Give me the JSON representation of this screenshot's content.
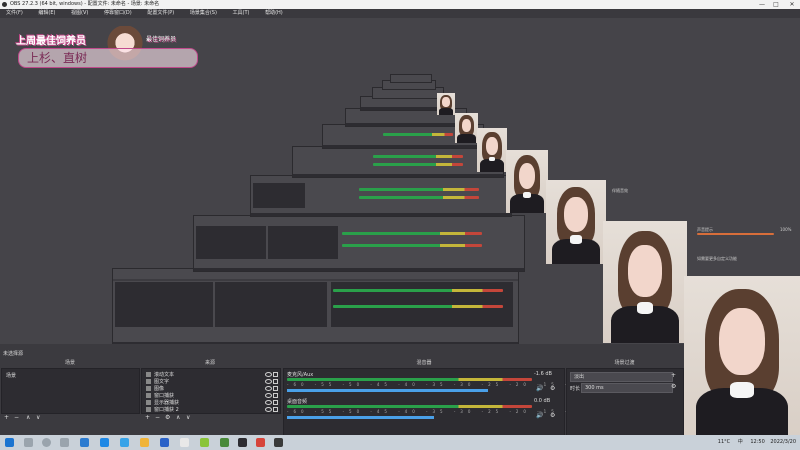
{
  "window": {
    "title": "OBS 27.2.3 (64 bit, windows) - 配置文件: 未命名 - 场景: 未命名",
    "minimize": "—",
    "maximize": "□",
    "close": "✕"
  },
  "menu": [
    "文件(F)",
    "编辑(E)",
    "视图(V)",
    "停靠窗口(D)",
    "配置文件(P)",
    "场景集合(S)",
    "工具(T)",
    "帮助(H)"
  ],
  "overlay": {
    "title": "上周最佳饲养员",
    "badge": "最佳饲养员",
    "names": "上杉、直树",
    "tag_right": "直树"
  },
  "docks": {
    "scenes_header": "场景",
    "sources_header": "来源",
    "mixer_header": "混音器",
    "transitions_header": "场景过渡",
    "preview_label": "未选择源",
    "scenes": [
      "场景"
    ],
    "sources": [
      "滚动文本",
      "图文字",
      "图像",
      "窗口捕获",
      "显示器捕获",
      "窗口捕获 2"
    ],
    "mixer": [
      {
        "name": "麦克风/Aux",
        "db": "-1.6 dB",
        "level": 0.82
      },
      {
        "name": "桌面音频",
        "db": "0.0 dB",
        "level": 0.6
      }
    ],
    "mixer_ticks": "-60 -55 -50 -45 -40 -35 -30 -25 -20 -15 -10 -5 0",
    "transition": "淡出",
    "duration_label": "时长",
    "duration": "300 ms",
    "add": "+",
    "remove": "−",
    "up": "∧",
    "down": "∨",
    "gear": "⚙"
  },
  "remote": {
    "label1": "声音提示",
    "label2": "伴随音效",
    "value": "100%",
    "text3": "如需要更多自定义功能",
    "level": 0.85
  },
  "taskbar": {
    "temp": "11°C",
    "lang": "中",
    "time": "12:50",
    "date": "2022/3/20"
  },
  "colors": {
    "accent_pink": "#c6488a",
    "panel_bg": "#2d2c31",
    "body_bg": "#454449",
    "meter_green": "#2aa04a",
    "meter_blue": "#4aa0e8"
  }
}
